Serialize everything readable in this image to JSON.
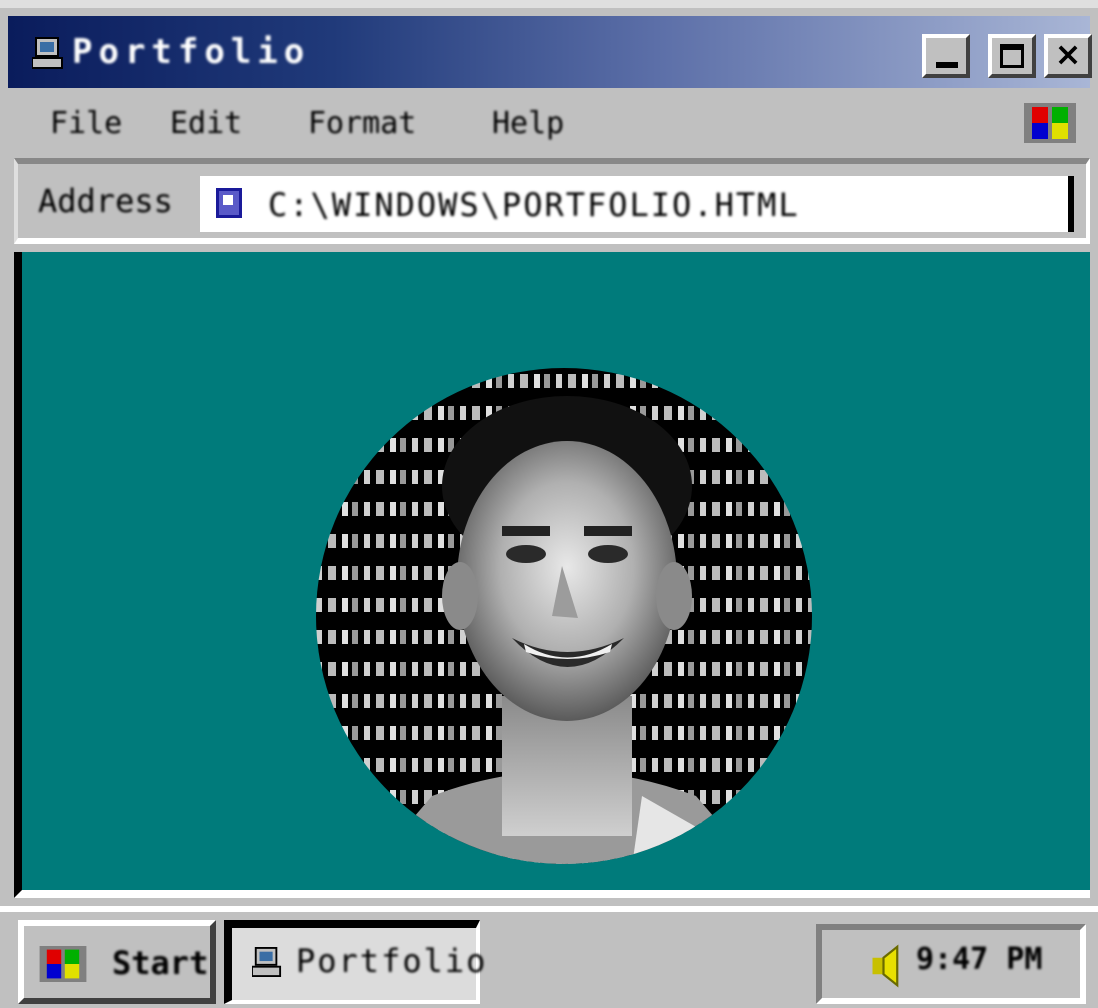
{
  "window": {
    "title": "Portfolio"
  },
  "menu": {
    "items": [
      "File",
      "Edit",
      "Format",
      "Help"
    ]
  },
  "address": {
    "label": "Address",
    "value": "C:\\WINDOWS\\PORTFOLIO.HTML"
  },
  "content": {
    "portrait_alt": "Portrait"
  },
  "taskbar": {
    "start_label": "Start",
    "tasks": [
      {
        "label": "Portfolio",
        "icon": "computer-icon",
        "active": true
      }
    ],
    "tray": {
      "clock": "9:47 PM",
      "icon": "speaker-icon"
    }
  },
  "colors": {
    "desktop": "#007b7b",
    "chrome": "#c0c0c0",
    "titlebar_start": "#0a1c5c",
    "titlebar_end": "#a9b6d6"
  }
}
